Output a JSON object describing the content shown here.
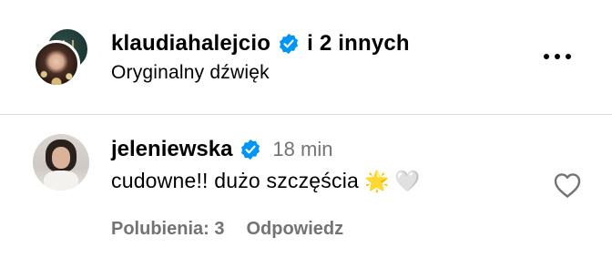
{
  "post": {
    "author": "klaudiahalejcio",
    "others": "i 2 innych",
    "audio": "Oryginalny dźwięk",
    "more_icon": "more-horizontal-icon"
  },
  "comment": {
    "username": "jeleniewska",
    "time": "18 min",
    "text": "cudowne!! dużo szczęścia",
    "emoji_1": "🌟",
    "emoji_2": "🤍",
    "likes_label": "Polubienia: 3",
    "reply_label": "Odpowiedz"
  },
  "colors": {
    "verified": "#0095f6",
    "muted": "#737373",
    "divider": "#dbdbdb"
  }
}
